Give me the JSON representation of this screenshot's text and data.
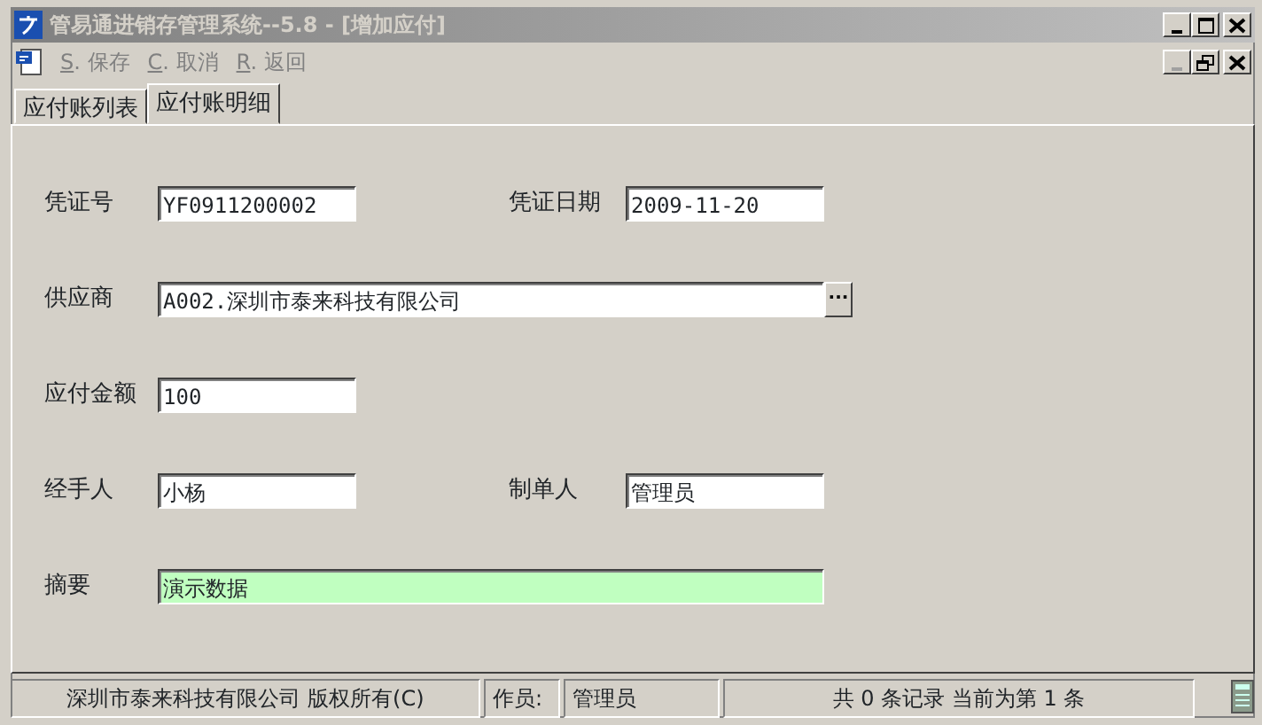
{
  "window": {
    "title": "管易通进销存管理系统--5.8 - [增加应付]"
  },
  "window_controls": [
    {
      "kind": "minimize",
      "disabled": false
    },
    {
      "kind": "maximize",
      "disabled": false
    },
    {
      "kind": "close",
      "disabled": false
    }
  ],
  "child_controls": [
    {
      "kind": "minimize",
      "disabled": true
    },
    {
      "kind": "restore",
      "disabled": false
    },
    {
      "kind": "close",
      "disabled": false
    }
  ],
  "toolbar": [
    {
      "key": "S",
      "label": ". 保存"
    },
    {
      "key": "C",
      "label": ". 取消"
    },
    {
      "key": "R",
      "label": ". 返回"
    }
  ],
  "tabs": [
    {
      "label": "应付账列表",
      "selected": false
    },
    {
      "label": "应付账明细",
      "selected": true
    }
  ],
  "form": [
    {
      "fields": [
        {
          "label": "凭证号",
          "value": "YF0911200002"
        },
        {
          "label": "凭证日期",
          "value": "2009-11-20"
        }
      ]
    },
    {
      "fields": [
        {
          "label": "供应商",
          "value": "A002.深圳市泰来科技有限公司",
          "wide": true,
          "lookup": "···"
        }
      ]
    },
    {
      "fields": [
        {
          "label": "应付金额",
          "value": "100"
        }
      ]
    },
    {
      "fields": [
        {
          "label": "经手人",
          "value": "小杨"
        },
        {
          "label": "制单人",
          "value": "管理员"
        }
      ]
    },
    {
      "fields": [
        {
          "label": "摘要",
          "value": "演示数据",
          "wide": true,
          "highlighted": true
        }
      ]
    }
  ],
  "status_bar": [
    "深圳市泰来科技有限公司 版权所有(C)",
    "作员:",
    "管理员",
    "共 0 条记录 当前为第 1 条"
  ]
}
